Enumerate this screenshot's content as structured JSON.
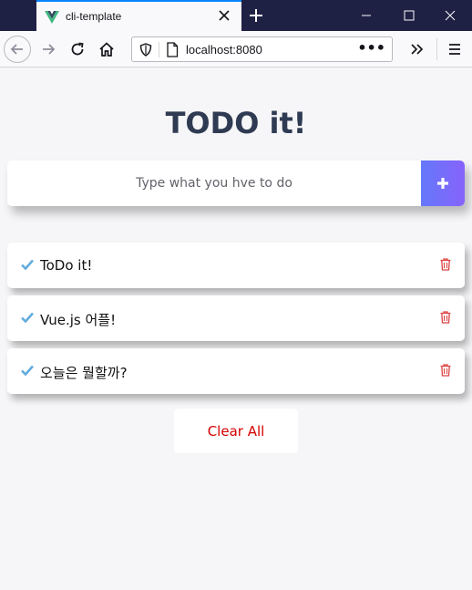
{
  "browser": {
    "tab_title": "cli-template",
    "url": "localhost:8080",
    "url_more": "•••"
  },
  "app": {
    "title": "TODO it!",
    "input_placeholder": "Type what you hve to do",
    "add_button_symbol": "+",
    "todos": [
      {
        "text": "ToDo it!"
      },
      {
        "text": "Vue.js 어플!"
      },
      {
        "text": "오늘은 뭘할까?"
      }
    ],
    "clear_label": "Clear All"
  },
  "colors": {
    "accent_gradient_start": "#6478fb",
    "accent_gradient_end": "#8763fb",
    "check": "#62acde",
    "trash": "#de4343",
    "clear_text": "#d40000",
    "title": "#2f3b52",
    "titlebar": "#1f2144"
  }
}
